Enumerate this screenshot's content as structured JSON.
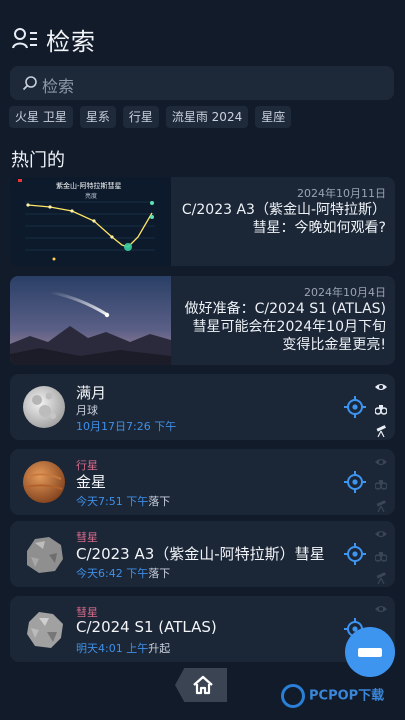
{
  "header": {
    "title": "检索",
    "menu_icon": "user-list-icon"
  },
  "search": {
    "placeholder": "检索",
    "icon": "search-icon"
  },
  "chips": [
    "火星 卫星",
    "星系",
    "行星",
    "流星雨 2024",
    "星座"
  ],
  "section_title": "热门的",
  "news": [
    {
      "date": "2024年10月11日",
      "headline": "C/2023 A3（紫金山-阿特拉斯）彗星：今晚如何观看?",
      "thumb_title": "紫金山-阿特拉斯彗星",
      "thumb_subtitle": "亮度"
    },
    {
      "date": "2024年10月4日",
      "headline": "做好准备：C/2024 S1 (ATLAS)彗星可能会在2024年10月下旬变得比金星更亮!"
    }
  ],
  "objects": [
    {
      "category": "",
      "name": "满月",
      "subtitle": "月球",
      "time": "10月17日7:26 下午",
      "event": "",
      "visibility": [
        true,
        true,
        true
      ]
    },
    {
      "category": "行星",
      "name": "金星",
      "subtitle": "",
      "time": "今天7:51 下午",
      "event": "落下",
      "visibility": [
        false,
        false,
        false
      ]
    },
    {
      "category": "彗星",
      "name": "C/2023 A3（紫金山-阿特拉斯）彗星",
      "subtitle": "",
      "time": "今天6:42 下午",
      "event": "落下",
      "visibility": [
        false,
        false,
        false
      ]
    },
    {
      "category": "彗星",
      "name": "C/2024 S1 (ATLAS)",
      "subtitle": "",
      "time": "明天4:01 上午",
      "event": "升起",
      "visibility": [
        false,
        false,
        false
      ]
    }
  ],
  "watermark": "PCPOP下载",
  "colors": {
    "accent": "#3d95f0",
    "category": "#d76b8b",
    "background": "#121b2a",
    "card": "#1b2636"
  }
}
